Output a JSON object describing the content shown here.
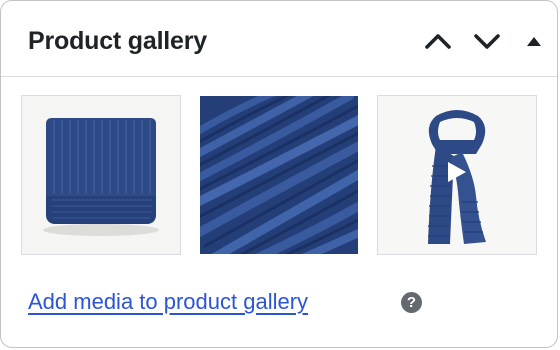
{
  "panel": {
    "title": "Product gallery",
    "controls": {
      "move_up_icon": "chevron-up-icon",
      "move_down_icon": "chevron-down-icon",
      "toggle_icon": "triangle-up-icon"
    }
  },
  "gallery": {
    "images": [
      {
        "name": "folded-scarf-image",
        "subject": "folded navy knit scarf",
        "color": "#2e4a86"
      },
      {
        "name": "knit-texture-image",
        "subject": "close-up of navy rib knit texture",
        "color": "#24407a"
      },
      {
        "name": "draped-scarf-image",
        "subject": "navy scarf draped",
        "color": "#2e4a86"
      }
    ]
  },
  "footer": {
    "add_link": "Add media to product gallery",
    "help_glyph": "?"
  },
  "colors": {
    "link": "#2c54d6",
    "title": "#1d2327",
    "border": "#c3c4c7",
    "help_bg": "#646970"
  }
}
